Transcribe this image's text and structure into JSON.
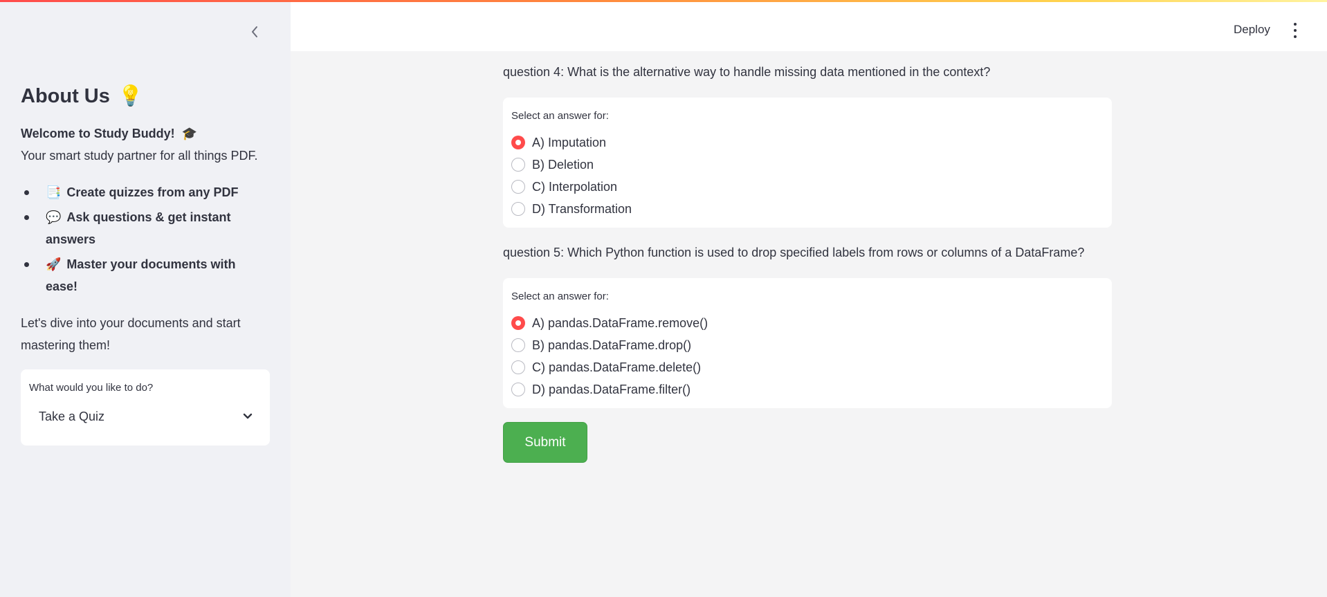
{
  "sidebar": {
    "title": "About Us",
    "title_emoji": "💡",
    "welcome": "Welcome to Study Buddy!",
    "welcome_emoji": "🎓",
    "tagline": "Your smart study partner for all things PDF.",
    "features": [
      {
        "emoji": "📑",
        "text": "Create quizzes from any PDF"
      },
      {
        "emoji": "💬",
        "text": "Ask questions & get instant answers"
      },
      {
        "emoji": "🚀",
        "text": "Master your documents with ease!"
      }
    ],
    "closing": "Let's dive into your documents and start mastering them!",
    "select": {
      "label": "What would you like to do?",
      "value": "Take a Quiz"
    }
  },
  "header": {
    "deploy_label": "Deploy"
  },
  "questions": [
    {
      "text": "question 4: What is the alternative way to handle missing data mentioned in the context?",
      "prompt": "Select an answer for:",
      "options": [
        "A) Imputation",
        "B) Deletion",
        "C) Interpolation",
        "D) Transformation"
      ],
      "selected": 0
    },
    {
      "text": "question 5: Which Python function is used to drop specified labels from rows or columns of a DataFrame?",
      "prompt": "Select an answer for:",
      "options": [
        "A) pandas.DataFrame.remove()",
        "B) pandas.DataFrame.drop()",
        "C) pandas.DataFrame.delete()",
        "D) pandas.DataFrame.filter()"
      ],
      "selected": 0
    }
  ],
  "submit_label": "Submit",
  "colors": {
    "accent": "#ff4b4b",
    "submit": "#4caf50",
    "sidebar_bg": "#f0f1f5",
    "main_bg": "#f4f4f5"
  }
}
